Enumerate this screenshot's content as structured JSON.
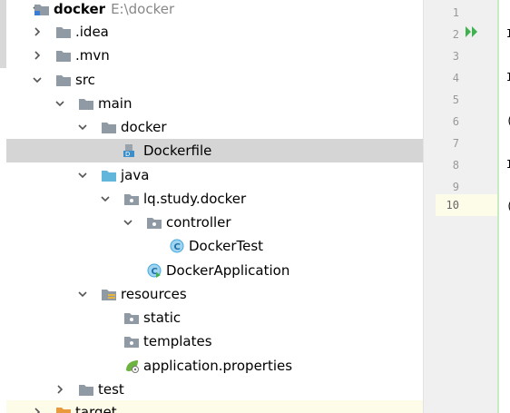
{
  "tree": {
    "root": {
      "name": "docker",
      "path": "E:\\docker"
    },
    "items": [
      {
        "name": ".idea"
      },
      {
        "name": ".mvn"
      },
      {
        "name": "src"
      },
      {
        "name": "main"
      },
      {
        "name": "docker"
      },
      {
        "name": "Dockerfile"
      },
      {
        "name": "java"
      },
      {
        "name": "lq.study.docker"
      },
      {
        "name": "controller"
      },
      {
        "name": "DockerTest"
      },
      {
        "name": "DockerApplication"
      },
      {
        "name": "resources"
      },
      {
        "name": "static"
      },
      {
        "name": "templates"
      },
      {
        "name": "application.properties"
      },
      {
        "name": "test"
      },
      {
        "name": "target"
      }
    ]
  },
  "editor": {
    "line_numbers": [
      "1",
      "2",
      "3",
      "4",
      "5",
      "6",
      "7",
      "8",
      "9",
      "10"
    ],
    "current_line": "10"
  },
  "colors": {
    "selection": "#d5d5d5",
    "folder": "#8f9aa5",
    "source_folder": "#62b6dc",
    "run_green": "#3fb24f",
    "class_blue": "#41a7dd"
  }
}
